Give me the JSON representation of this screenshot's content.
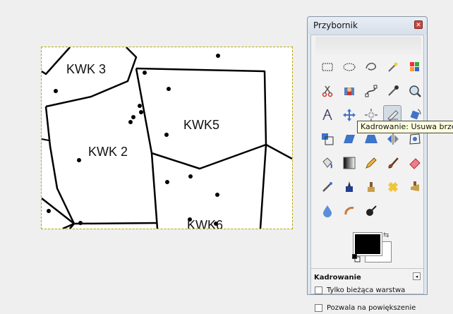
{
  "image": {
    "labels": {
      "kwk3": "KWK 3",
      "kwk2": "KWK 2",
      "kwk5": "KWK5",
      "kwk6": "KWK6"
    }
  },
  "toolbox": {
    "title": "Przybornik",
    "close_glyph": "✕",
    "tools": [
      {
        "icon": "rect-select-icon"
      },
      {
        "icon": "ellipse-select-icon"
      },
      {
        "icon": "free-select-icon"
      },
      {
        "icon": "fuzzy-select-icon"
      },
      {
        "icon": "select-by-color-icon"
      },
      {
        "icon": "scissors-icon"
      },
      {
        "icon": "foreground-select-icon"
      },
      {
        "icon": "paths-icon"
      },
      {
        "icon": "color-picker-icon"
      },
      {
        "icon": "zoom-icon"
      },
      {
        "icon": "measure-icon"
      },
      {
        "icon": "move-icon"
      },
      {
        "icon": "align-icon"
      },
      {
        "icon": "crop-icon"
      },
      {
        "icon": "rotate-icon"
      },
      {
        "icon": "scale-icon"
      },
      {
        "icon": "shear-icon"
      },
      {
        "icon": "perspective-icon"
      },
      {
        "icon": "flip-icon"
      },
      {
        "icon": "cage-icon"
      },
      {
        "icon": "bucket-fill-icon"
      },
      {
        "icon": "blend-icon"
      },
      {
        "icon": "pencil-icon"
      },
      {
        "icon": "paintbrush-icon"
      },
      {
        "icon": "eraser-icon"
      },
      {
        "icon": "airbrush-icon"
      },
      {
        "icon": "ink-icon"
      },
      {
        "icon": "clone-icon"
      },
      {
        "icon": "heal-icon"
      },
      {
        "icon": "perspective-clone-icon"
      },
      {
        "icon": "blur-icon"
      },
      {
        "icon": "smudge-icon"
      },
      {
        "icon": "dodge-burn-icon"
      }
    ],
    "active_tool": "crop-icon",
    "tooltip": "Kadrowanie: Usuwa brzegi",
    "colors": {
      "foreground": "#000000",
      "background": "#ffffff"
    },
    "options": {
      "title": "Kadrowanie",
      "menu_glyph": "◂",
      "checkboxes": [
        {
          "label": "Tylko bieżąca warstwa",
          "checked": false
        },
        {
          "label": "Pozwala na powiększenie",
          "checked": false
        }
      ]
    }
  }
}
